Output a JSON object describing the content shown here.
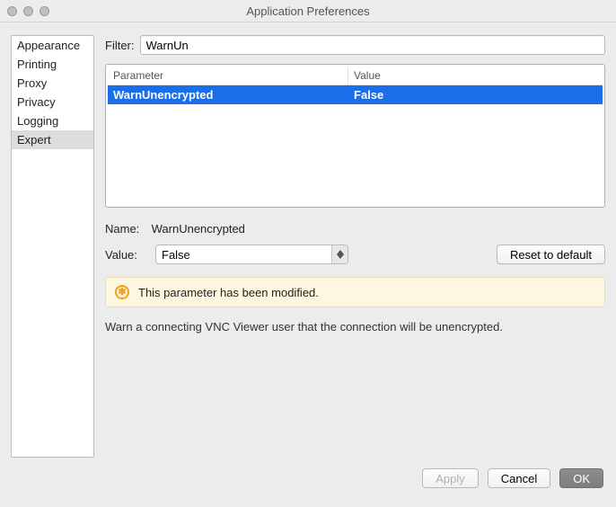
{
  "window": {
    "title": "Application Preferences"
  },
  "sidebar": {
    "items": [
      {
        "label": "Appearance"
      },
      {
        "label": "Printing"
      },
      {
        "label": "Proxy"
      },
      {
        "label": "Privacy"
      },
      {
        "label": "Logging"
      },
      {
        "label": "Expert"
      }
    ],
    "selected_index": 5
  },
  "main": {
    "filter_label": "Filter:",
    "filter_value": "WarnUn",
    "columns": {
      "parameter": "Parameter",
      "value": "Value"
    },
    "rows": [
      {
        "parameter": "WarnUnencrypted",
        "value": "False",
        "selected": true
      }
    ],
    "name_label": "Name:",
    "name_value": "WarnUnencrypted",
    "value_label": "Value:",
    "value_current": "False",
    "reset_label": "Reset to default",
    "notice_text": "This parameter has been modified.",
    "description": "Warn a connecting VNC Viewer user that the connection will be unencrypted."
  },
  "footer": {
    "apply": "Apply",
    "cancel": "Cancel",
    "ok": "OK"
  }
}
